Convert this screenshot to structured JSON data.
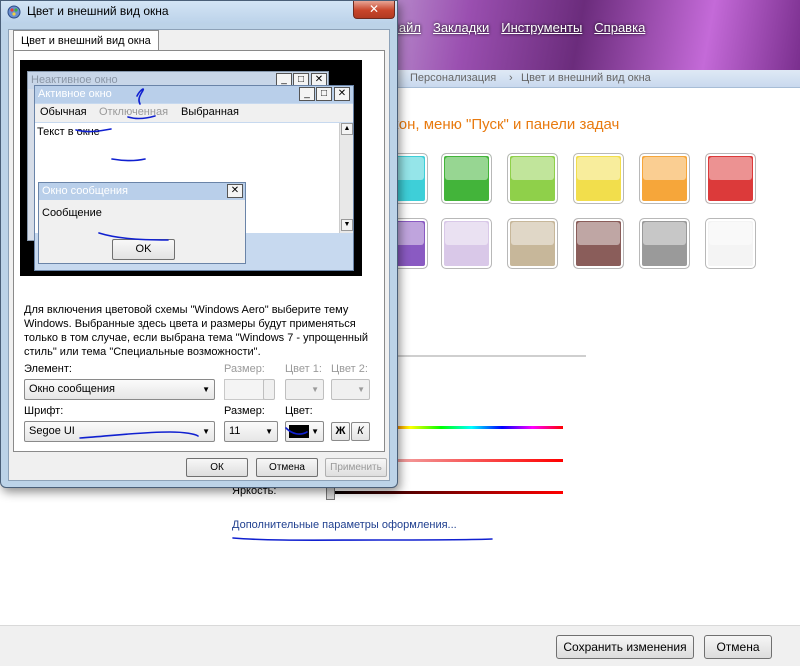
{
  "background_window": {
    "menu": [
      "Файл",
      "Закладки",
      "Инструменты",
      "Справка"
    ],
    "breadcrumb": [
      "Персонализация",
      "Цвет и внешний вид окна"
    ],
    "heading": "кон, меню \"Пуск\" и панели задач",
    "swatch_colors": {
      "row1": [
        "#3ecfd8",
        "#43b43a",
        "#8fd04a",
        "#f2de4c",
        "#f6a63a",
        "#dc3a3a"
      ],
      "row2": [
        "#8a5ac2",
        "#d9c8e8",
        "#c7b79a",
        "#8a5d5a",
        "#9a9a9a",
        "#f4f4f4"
      ]
    },
    "brightness_label": "Яркость:",
    "advanced_link": "Дополнительные параметры оформления...",
    "save_button": "Сохранить изменения",
    "cancel_button": "Отмена"
  },
  "dialog": {
    "title": "Цвет и внешний вид окна",
    "close_glyph": "✕",
    "tab_label": "Цвет и внешний вид окна",
    "preview": {
      "inactive_window_title": "Неактивное окно",
      "active_window_title": "Активное окно",
      "menu_items": [
        "Обычная",
        "Отключенная",
        "Выбранная"
      ],
      "window_text": "Текст в окне",
      "message_box_title": "Окно сообщения",
      "message_text": "Сообщение",
      "ok_button": "OK"
    },
    "description": "Для включения цветовой схемы \"Windows Aero\" выберите тему Windows.  Выбранные здесь цвета и размеры будут применяться только в том случае, если выбрана тема \"Windows 7 - упрощенный стиль\" или тема \"Специальные возможности\".",
    "element_label": "Элемент:",
    "element_value": "Окно сообщения",
    "size1_label": "Размер:",
    "color1_label": "Цвет 1:",
    "color2_label": "Цвет 2:",
    "font_label": "Шрифт:",
    "font_value": "Segoe UI",
    "size2_label": "Размер:",
    "size2_value": "11",
    "color_label": "Цвет:",
    "font_color": "#000000",
    "bold_label": "Ж",
    "italic_label": "К",
    "ok_button": "ОК",
    "cancel_button": "Отмена",
    "apply_button": "Применить"
  }
}
